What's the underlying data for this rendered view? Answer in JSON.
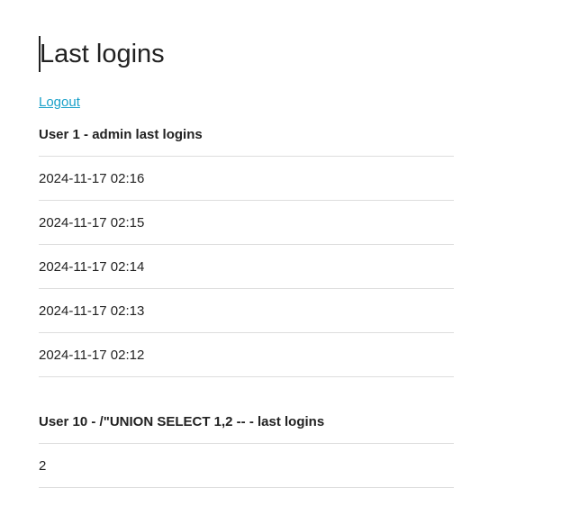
{
  "page": {
    "title": "Last logins",
    "logout_label": "Logout"
  },
  "users": [
    {
      "heading": "User 1 - admin last logins",
      "logins": [
        "2024-11-17 02:16",
        "2024-11-17 02:15",
        "2024-11-17 02:14",
        "2024-11-17 02:13",
        "2024-11-17 02:12"
      ]
    },
    {
      "heading": "User 10 - /\"UNION SELECT 1,2 -- - last logins",
      "logins": [
        "2"
      ]
    }
  ],
  "colors": {
    "link": "#1ba1c9",
    "text": "#222222",
    "divider": "#dddddd"
  }
}
